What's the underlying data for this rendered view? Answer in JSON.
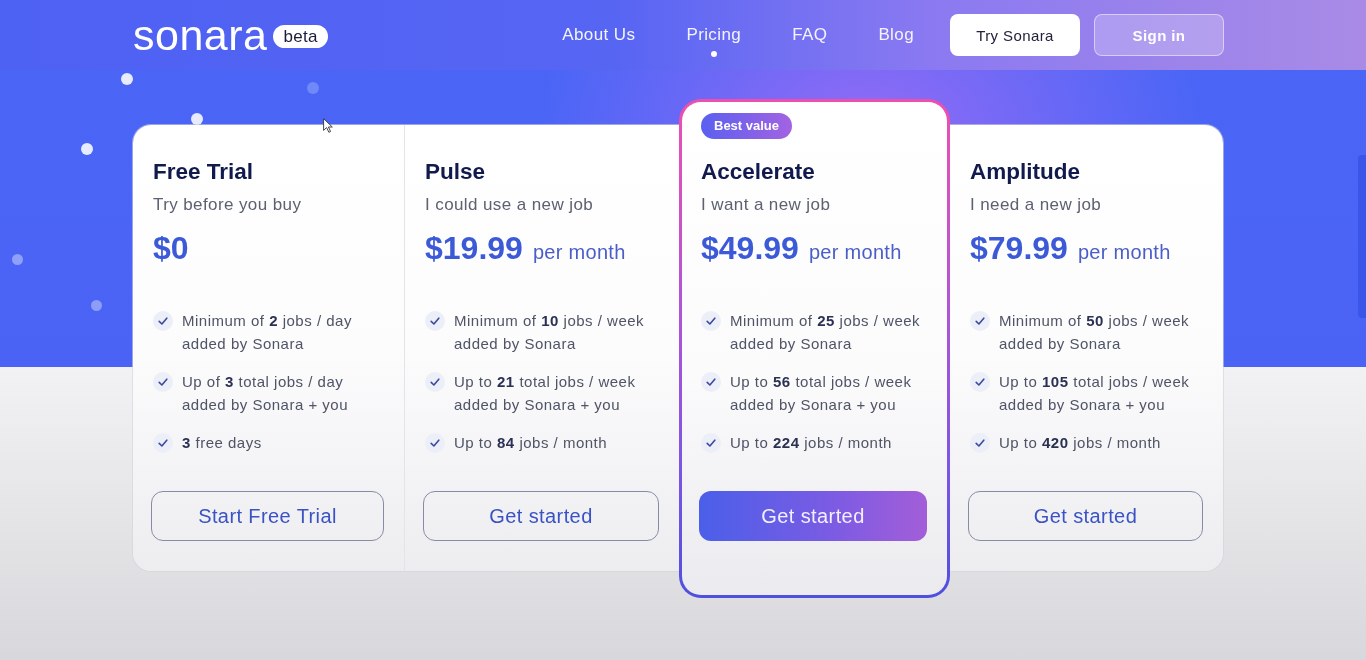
{
  "header": {
    "logo": "sonara",
    "logo_badge": "beta",
    "nav": [
      {
        "label": "About Us",
        "selected": false
      },
      {
        "label": "Pricing",
        "selected": true
      },
      {
        "label": "FAQ",
        "selected": false
      },
      {
        "label": "Blog",
        "selected": false
      }
    ],
    "buttons": [
      {
        "label": "Try Sonara",
        "kind": "primary"
      },
      {
        "label": "Sign in",
        "kind": "secondary"
      }
    ]
  },
  "plans": [
    {
      "name": "Free Trial",
      "tagline": "Try before you buy",
      "price": "$0",
      "features": [
        "Minimum of **2** jobs / day added by Sonara",
        "Up of **3** total jobs / day added by Sonara + you",
        "**3** free days"
      ],
      "button": "Start Free Trial",
      "featured": false
    },
    {
      "name": "Pulse",
      "tagline": "I could use a new job",
      "price": "$19.99",
      "period": "per month",
      "features": [
        "Minimum of **10** jobs / week added by Sonara",
        "Up to **21** total jobs / week added by Sonara + you",
        "Up to **84** jobs / month"
      ],
      "button": "Get started",
      "featured": false
    },
    {
      "name": "Accelerate",
      "badge": "Best value",
      "tagline": "I want a new job",
      "price": "$49.99",
      "period": "per month",
      "features": [
        "Minimum of **25** jobs / week added by Sonara",
        "Up to **56** total jobs / week added by Sonara + you",
        "Up to **224** jobs / month"
      ],
      "button": "Get started",
      "featured": true
    },
    {
      "name": "Amplitude",
      "tagline": "I need a new job",
      "price": "$79.99",
      "period": "per month",
      "features": [
        "Minimum of **50** jobs / week added by Sonara",
        "Up to **105** total jobs / week added by Sonara + you",
        "Up to **420** jobs / month"
      ],
      "button": "Get started",
      "featured": false
    }
  ]
}
